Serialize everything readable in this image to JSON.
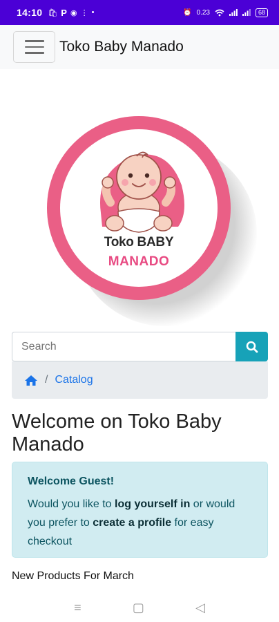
{
  "status_bar": {
    "time": "14:10",
    "left_icons": [
      "bag-icon",
      "p-icon",
      "messenger-icon",
      "dots-icon"
    ],
    "right_icons": [
      "alarm-icon",
      "data-speed",
      "wifi-icon",
      "signal-icon",
      "signal-icon",
      "battery-icon"
    ],
    "data_speed": "0.23",
    "battery": "68"
  },
  "navbar": {
    "brand": "Toko Baby Manado"
  },
  "logo": {
    "line1": "Toko BABY",
    "line2": "MANADO",
    "ring_color": "#ea5f86"
  },
  "search": {
    "placeholder": "Search"
  },
  "breadcrumb": {
    "separator": "/",
    "current": "Catalog"
  },
  "page": {
    "title": "Welcome on Toko Baby Manado",
    "alert": {
      "heading": "Welcome Guest!",
      "text_1": "Would you like to ",
      "link_1": "log yourself in",
      "text_2": " or would you prefer to ",
      "link_2": "create a profile",
      "text_3": " for easy checkout"
    },
    "section_title": "New Products For March"
  },
  "colors": {
    "status_bar": "#4b00d6",
    "accent": "#17a2b8",
    "link": "#1a73e8"
  }
}
